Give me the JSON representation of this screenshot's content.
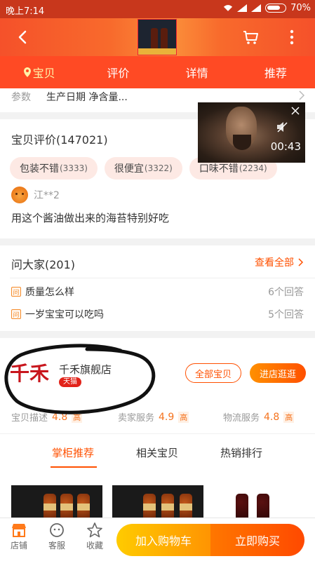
{
  "status_bar": {
    "time": "晚上7:14",
    "battery": "70%"
  },
  "tabs": [
    "宝贝",
    "评价",
    "详情",
    "推荐"
  ],
  "params": {
    "label": "参数",
    "value": "生产日期 净含量..."
  },
  "reviews": {
    "title": "宝贝评价(147021)",
    "tags": [
      {
        "text": "包装不错",
        "count": "(3333)"
      },
      {
        "text": "很便宜",
        "count": "(3322)"
      },
      {
        "text": "口味不错",
        "count": "(2234)"
      }
    ],
    "reviewer": "江**2",
    "text": "用这个酱油做出来的海苔特别好吃"
  },
  "video": {
    "time": "00:43"
  },
  "ask": {
    "title": "问大家(201)",
    "view_all": "查看全部",
    "q_icon": "问",
    "questions": [
      {
        "q": "质量怎么样",
        "count": "6个回答"
      },
      {
        "q": "一岁宝宝可以吃吗",
        "count": "5个回答"
      }
    ]
  },
  "shop": {
    "logo_text": "千禾",
    "name": "千禾旗舰店",
    "badge": "天猫",
    "all_items": "全部宝贝",
    "enter": "进店逛逛",
    "scores": [
      {
        "label": "宝贝描述",
        "value": "4.8",
        "level": "高"
      },
      {
        "label": "卖家服务",
        "value": "4.9",
        "level": "高"
      },
      {
        "label": "物流服务",
        "value": "4.8",
        "level": "高"
      }
    ]
  },
  "recommend_tabs": [
    "掌柜推荐",
    "相关宝贝",
    "热销排行"
  ],
  "bottom_bar": {
    "shop": "店铺",
    "service": "客服",
    "favorite": "收藏",
    "add_cart": "加入购物车",
    "buy_now": "立即购买"
  },
  "colors": {
    "accent": "#ff5000",
    "tab_bar": "#ff4a24",
    "active_tab": "#fff2a8"
  }
}
